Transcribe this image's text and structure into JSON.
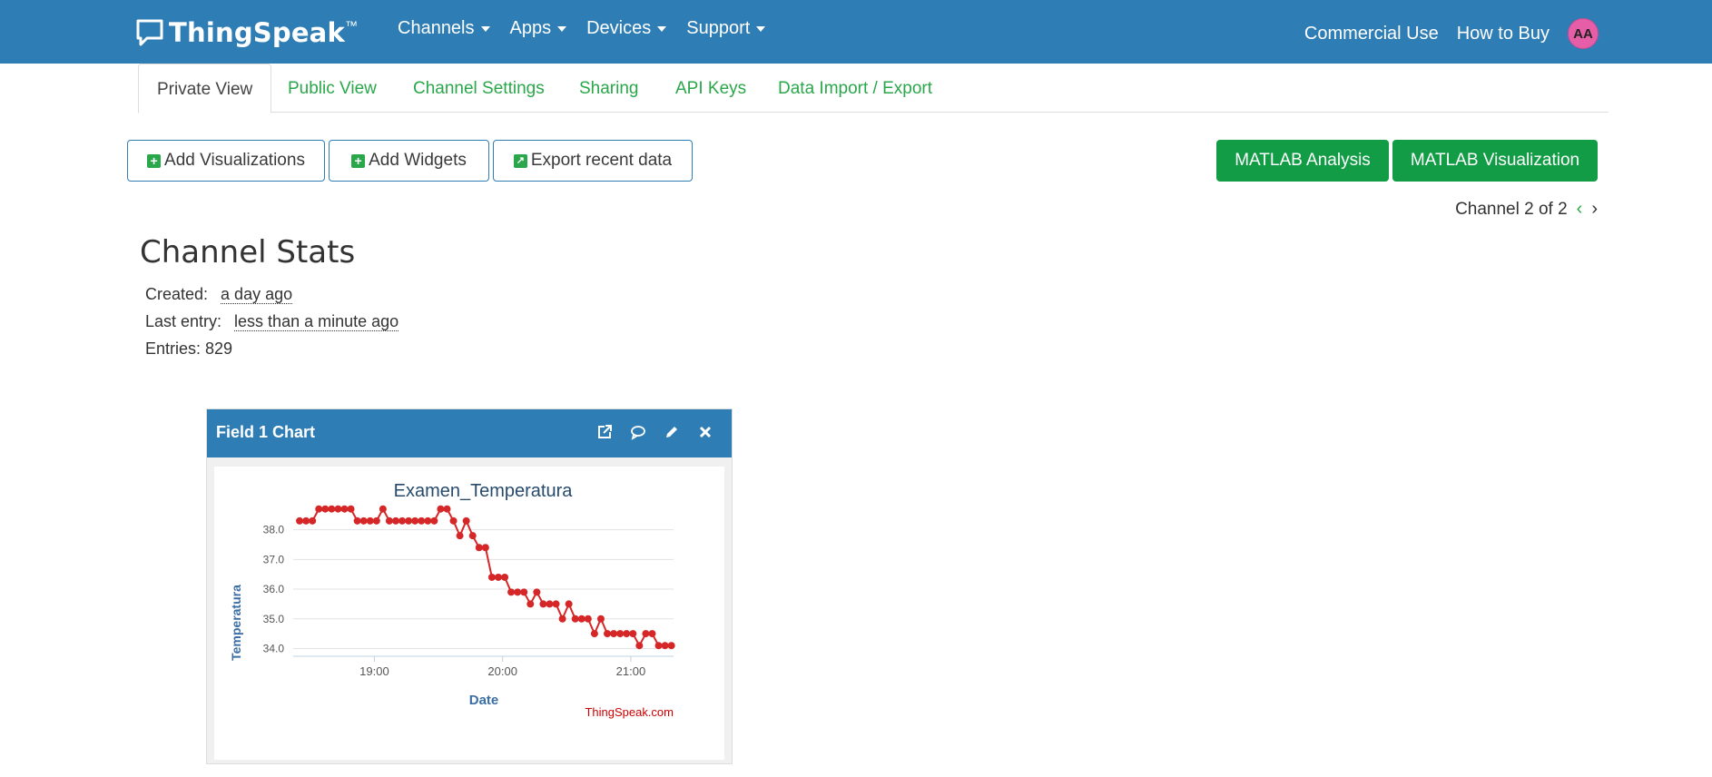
{
  "navbar": {
    "brand": "ThingSpeak",
    "brand_tm": "™",
    "menu": [
      {
        "label": "Channels"
      },
      {
        "label": "Apps"
      },
      {
        "label": "Devices"
      },
      {
        "label": "Support"
      }
    ],
    "commercial_use": "Commercial Use",
    "how_to_buy": "How to Buy",
    "avatar_initials": "AA"
  },
  "tabs": [
    {
      "label": "Private View",
      "active": true
    },
    {
      "label": "Public View"
    },
    {
      "label": "Channel Settings"
    },
    {
      "label": "Sharing"
    },
    {
      "label": "API Keys"
    },
    {
      "label": "Data Import / Export"
    }
  ],
  "toolbar": {
    "add_visualizations": "Add Visualizations",
    "add_widgets": "Add Widgets",
    "export_recent": "Export recent data",
    "matlab_analysis": "MATLAB Analysis",
    "matlab_visualization": "MATLAB Visualization"
  },
  "pager": {
    "text": "Channel 2 of 2"
  },
  "stats": {
    "title": "Channel Stats",
    "created_label": "Created:",
    "created_value": "a day ago",
    "last_entry_label": "Last entry:",
    "last_entry_value": "less than a minute ago",
    "entries_text": "Entries: 829"
  },
  "widget": {
    "title": "Field 1 Chart",
    "icons": [
      "external-link-icon",
      "comment-icon",
      "pencil-icon",
      "close-icon"
    ]
  },
  "colors": {
    "navbar": "#2e7db5",
    "green": "#129c45",
    "series": "#d62728",
    "axis_label": "#3b6ea5"
  },
  "chart_data": {
    "type": "line",
    "title": "Examen_Temperatura",
    "xlabel": "Date",
    "ylabel": "Temperatura",
    "credit": "ThingSpeak.com",
    "x_ticks": [
      "19:00",
      "20:00",
      "21:00"
    ],
    "y_ticks": [
      "34.0",
      "35.0",
      "36.0",
      "37.0",
      "38.0"
    ],
    "ylim": [
      33.8,
      38.6
    ],
    "xlim": [
      "18:22",
      "21:20"
    ],
    "series": [
      {
        "x": [
          "18:25",
          "18:28",
          "18:31",
          "18:34",
          "18:37",
          "18:40",
          "18:43",
          "18:46",
          "18:49",
          "18:52",
          "18:55",
          "18:58",
          "19:01",
          "19:04",
          "19:07",
          "19:10",
          "19:13",
          "19:16",
          "19:19",
          "19:22",
          "19:25",
          "19:28",
          "19:31",
          "19:34",
          "19:37",
          "19:40",
          "19:43",
          "19:46",
          "19:49",
          "19:52",
          "19:55",
          "19:58",
          "20:01",
          "20:04",
          "20:07",
          "20:10",
          "20:13",
          "20:16",
          "20:19",
          "20:22",
          "20:25",
          "20:28",
          "20:31",
          "20:34",
          "20:37",
          "20:40",
          "20:43",
          "20:46",
          "20:49",
          "20:52",
          "20:55",
          "20:58",
          "21:01",
          "21:04",
          "21:07",
          "21:10",
          "21:13",
          "21:16",
          "21:19"
        ],
        "y": [
          38.3,
          38.3,
          38.3,
          38.7,
          38.7,
          38.7,
          38.7,
          38.7,
          38.7,
          38.3,
          38.3,
          38.3,
          38.3,
          38.7,
          38.3,
          38.3,
          38.3,
          38.3,
          38.3,
          38.3,
          38.3,
          38.3,
          38.7,
          38.7,
          38.3,
          37.8,
          38.3,
          37.8,
          37.4,
          37.4,
          36.4,
          36.4,
          36.4,
          35.9,
          35.9,
          35.9,
          35.5,
          35.9,
          35.5,
          35.5,
          35.5,
          35.0,
          35.5,
          35.0,
          35.0,
          35.0,
          34.5,
          35.0,
          34.5,
          34.5,
          34.5,
          34.5,
          34.5,
          34.1,
          34.5,
          34.5,
          34.1,
          34.1,
          34.1
        ]
      }
    ]
  }
}
